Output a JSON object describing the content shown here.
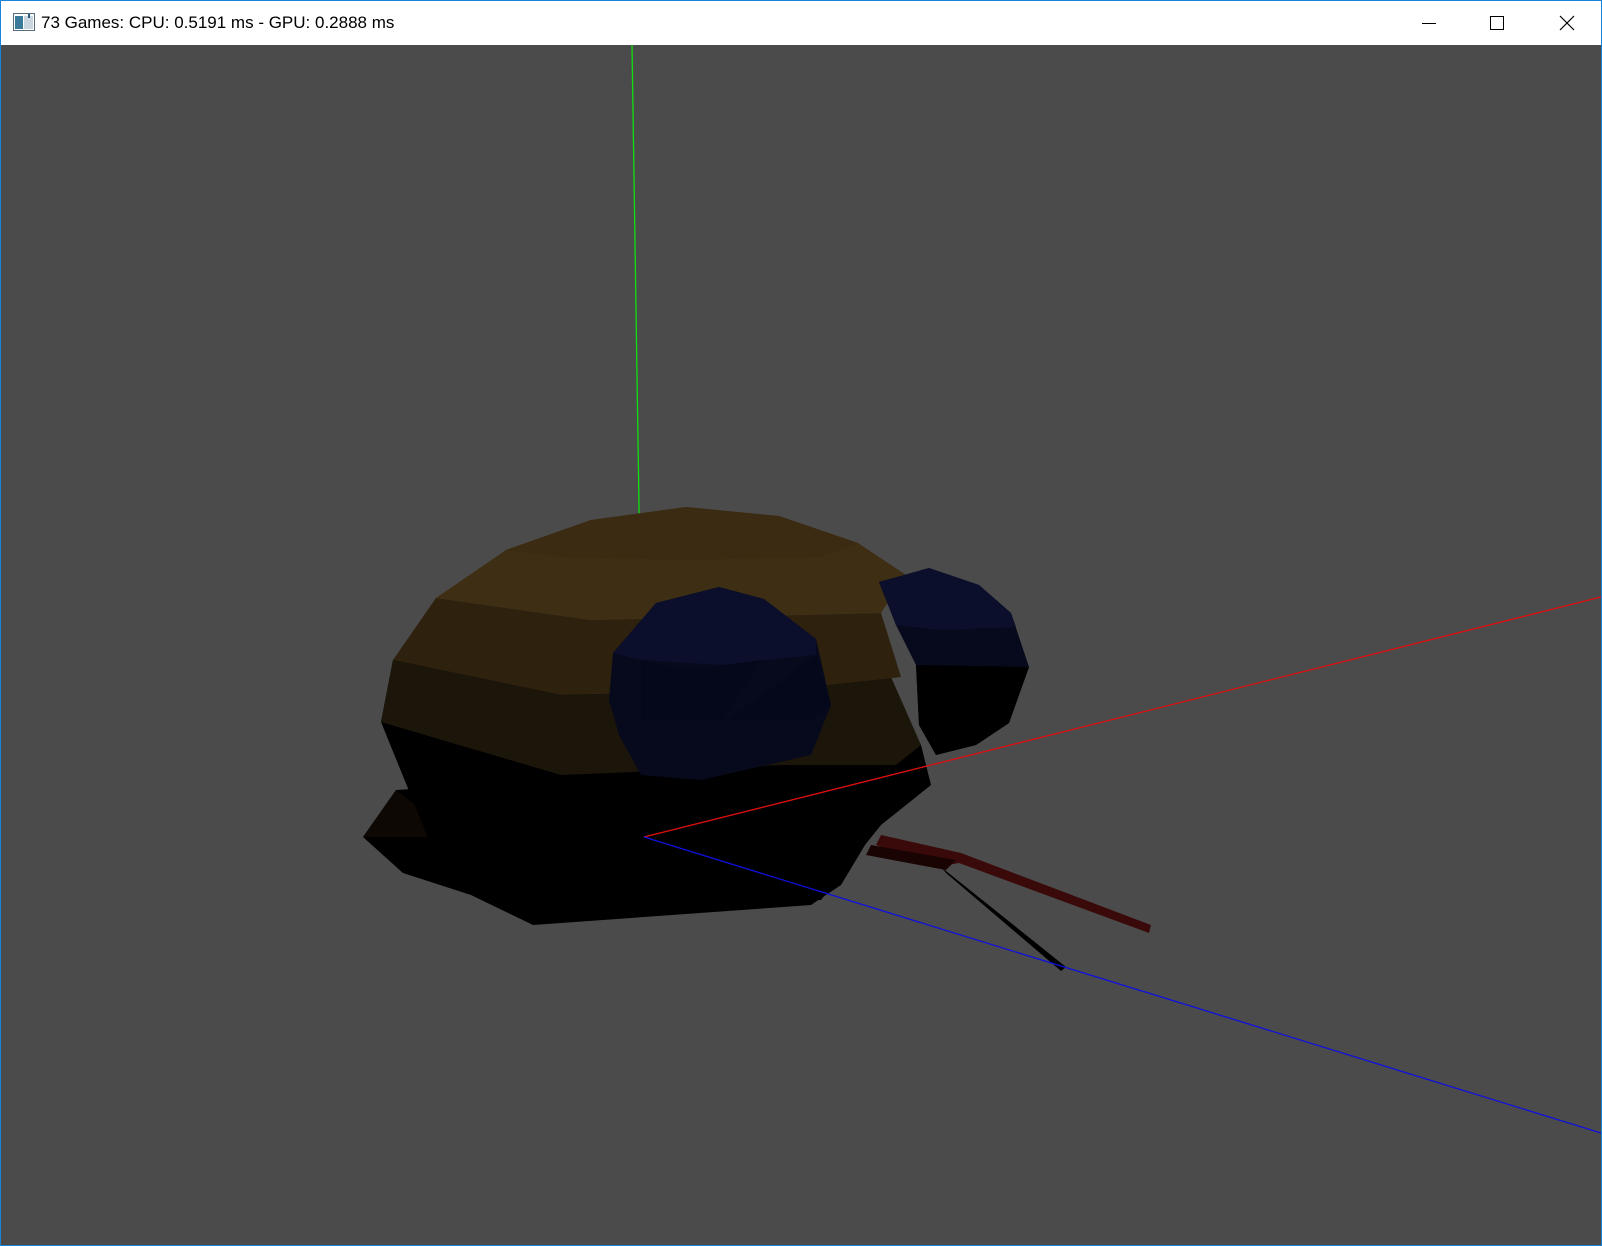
{
  "window": {
    "title": "73 Games: CPU: 0.5191 ms - GPU: 0.2888 ms",
    "icon": "app-window-icon",
    "controls": {
      "minimize": "minimize-icon",
      "maximize": "maximize-icon",
      "close": "close-icon"
    }
  },
  "scene": {
    "background_color": "#4b4b4b",
    "axes": {
      "x_color": "#e01010",
      "y_color": "#10e010",
      "z_color": "#1010e0"
    },
    "colors": {
      "shell_top": "#3e2e13",
      "shell_mid": "#2e210e",
      "shell_low": "#1c150a",
      "body": "#000000",
      "head": "#080c22",
      "tail": "#3a0a0a"
    }
  }
}
